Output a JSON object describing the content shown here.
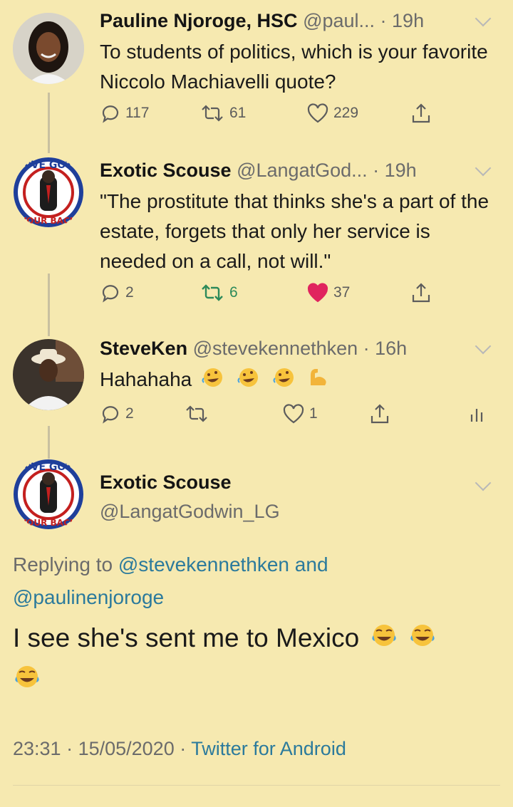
{
  "tweets": [
    {
      "name": "Pauline Njoroge, HSC",
      "handle": "@paul...",
      "time": "· 19h",
      "text": "To students of politics, which is your favorite Niccolo Machiavelli quote?",
      "replies": "117",
      "retweets": "61",
      "likes": "229"
    },
    {
      "name": "Exotic Scouse",
      "handle": "@LangatGod...",
      "time": "· 19h",
      "text": "\"The prostitute that thinks she's a part of the estate, forgets that only her service is needed on a call, not will.\"",
      "replies": "2",
      "retweets": "6",
      "likes": "37",
      "liked": true
    },
    {
      "name": "SteveKen",
      "handle": "@stevekennethken",
      "time": "· 16h",
      "text": "Hahahaha",
      "replies": "2",
      "retweets": "",
      "likes": "1"
    }
  ],
  "main_tweet": {
    "name": "Exotic Scouse",
    "handle": "@LangatGodwin_LG",
    "replying_prefix": "Replying to",
    "replying_user1": "@stevekennethken",
    "replying_and": "and",
    "replying_user2": "@paulinenjoroge",
    "text": "I see she's sent me to Mexico",
    "time": "23:31",
    "date": "15/05/2020",
    "source": "Twitter for Android"
  },
  "avatar_badge_text_top": "I'VE GOT",
  "avatar_badge_text_bottom": "YOUR BACK",
  "colors": {
    "background": "#f6e9b0",
    "link": "#2b7a9c",
    "like": "#c9244f"
  }
}
